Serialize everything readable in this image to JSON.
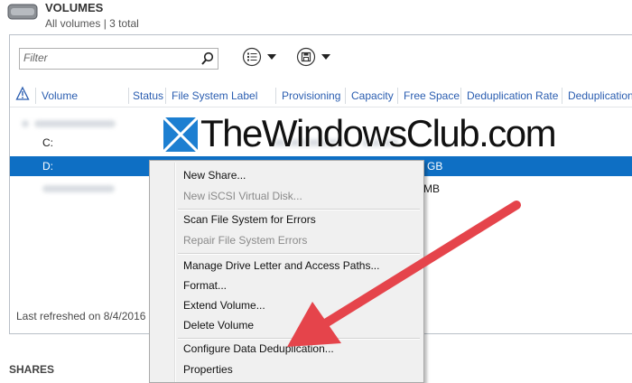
{
  "header": {
    "title": "VOLUMES",
    "subtitle": "All volumes | 3 total",
    "icon": "drive-icon"
  },
  "filter": {
    "placeholder": "Filter",
    "icon": "search-icon"
  },
  "toolbar": [
    {
      "name": "list-view-dropdown",
      "icon": "list-icon"
    },
    {
      "name": "save-view-dropdown",
      "icon": "save-icon"
    }
  ],
  "columns": [
    "Volume",
    "Status",
    "File System Label",
    "Provisioning",
    "Capacity",
    "Free Space",
    "Deduplication Rate",
    "Deduplication"
  ],
  "rows": [
    {
      "volume": "C:",
      "free_space": "",
      "selected": false
    },
    {
      "volume": "D:",
      "free_space": "GB",
      "selected": true
    },
    {
      "volume": "",
      "free_space": "MB",
      "selected": false
    }
  ],
  "footer": {
    "last_refreshed": "Last refreshed on 8/4/2016"
  },
  "shares_title": "SHARES",
  "watermark": "TheWindowsClub.com",
  "context_menu": {
    "groups": [
      [
        {
          "label": "New Share...",
          "enabled": true
        },
        {
          "label": "New iSCSI Virtual Disk...",
          "enabled": false
        }
      ],
      [
        {
          "label": "Scan File System for Errors",
          "enabled": true
        },
        {
          "label": "Repair File System Errors",
          "enabled": false
        }
      ],
      [
        {
          "label": "Manage Drive Letter and Access Paths...",
          "enabled": true
        },
        {
          "label": "Format...",
          "enabled": true
        },
        {
          "label": "Extend Volume...",
          "enabled": true
        },
        {
          "label": "Delete Volume",
          "enabled": true
        }
      ],
      [
        {
          "label": "Configure Data Deduplication...",
          "enabled": true
        },
        {
          "label": "Properties",
          "enabled": true
        }
      ]
    ]
  },
  "colors": {
    "accent": "#0e6fc4",
    "header_text": "#2a5db0",
    "arrow": "#e5444b"
  }
}
